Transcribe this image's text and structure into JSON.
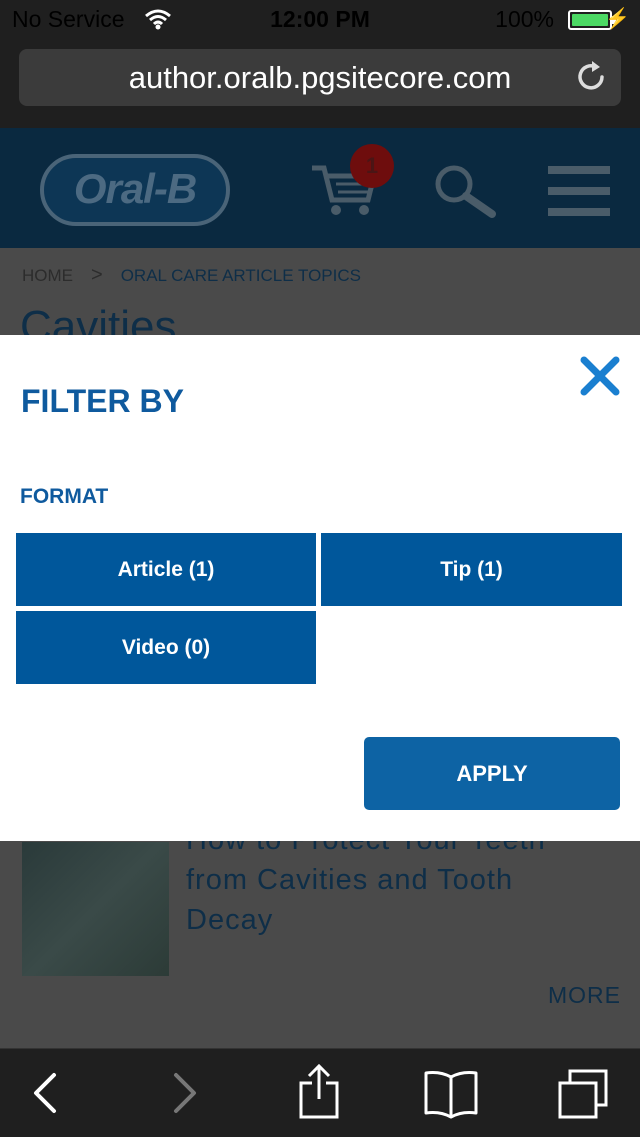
{
  "status": {
    "carrier": "No Service",
    "time": "12:00 PM",
    "battery": "100%"
  },
  "browser": {
    "url": "author.oralb.pgsitecore.com"
  },
  "header": {
    "logo_text": "Oral-B",
    "cart_count": "1"
  },
  "breadcrumb": {
    "home": "HOME",
    "separator": ">",
    "topic": "ORAL CARE ARTICLE TOPICS"
  },
  "page": {
    "title": "Cavities",
    "article_title": "How to Protect Your Teeth from Cavities and Tooth Decay",
    "more_label": "MORE"
  },
  "filter": {
    "title": "FILTER BY",
    "section": "FORMAT",
    "options": [
      {
        "label": "Article (1)"
      },
      {
        "label": "Tip (1)"
      },
      {
        "label": "Video (0)"
      }
    ],
    "apply_label": "APPLY"
  },
  "colors": {
    "brand_blue": "#00579b",
    "heading_blue": "#0f5a9e",
    "header_bg": "#0a2940"
  }
}
